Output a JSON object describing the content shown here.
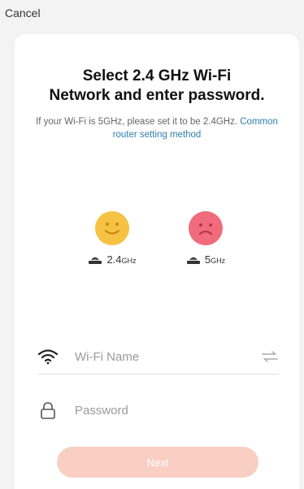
{
  "header": {
    "cancel_label": "Cancel"
  },
  "title": {
    "line1": "Select 2.4 GHz Wi-Fi",
    "line2": "Network and enter password."
  },
  "subtitle": {
    "text": "If your Wi-Fi is 5GHz, please set it to be 2.4GHz.",
    "link": "Common router setting method"
  },
  "bands": [
    {
      "value": "2.4",
      "unit": "GHz",
      "face": "happy-face-icon",
      "color": "#f6c244"
    },
    {
      "value": "5",
      "unit": "GHz",
      "face": "sad-face-icon",
      "color": "#f06b7c"
    }
  ],
  "form": {
    "wifi_placeholder": "Wi-Fi Name",
    "password_placeholder": "Password"
  },
  "next_label": "Next",
  "colors": {
    "accent_link": "#2f7fb0",
    "next_button": "#f9cfc4"
  }
}
